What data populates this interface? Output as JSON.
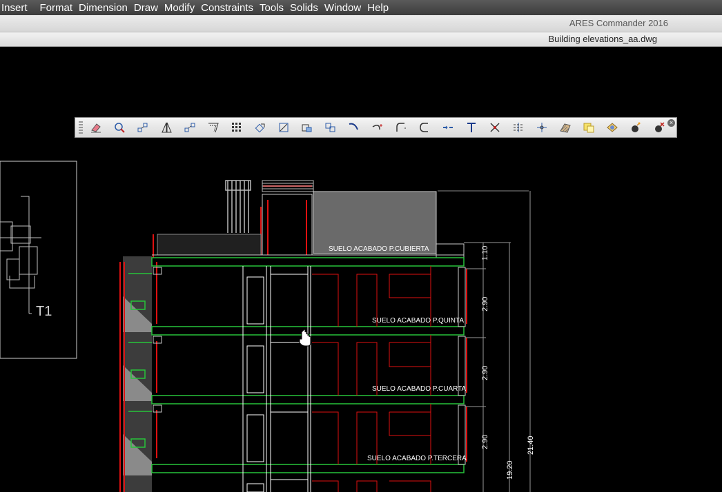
{
  "menu": [
    "Insert",
    "Format",
    "Dimension",
    "Draw",
    "Modify",
    "Constraints",
    "Tools",
    "Solids",
    "Window",
    "Help"
  ],
  "app_title": "ARES Commander 2016",
  "document_tab": "Building elevations_aa.dwg",
  "toolbar": {
    "tools": [
      "eraser-icon",
      "copy-icon",
      "mirror-icon",
      "offset-icon",
      "offset-parallel-icon",
      "chamfer-icon",
      "array-icon",
      "move-icon",
      "rotate-icon",
      "scale-icon",
      "stretch-icon",
      "trim-icon",
      "extend-icon",
      "fillet-icon",
      "arc-icon",
      "break-icon",
      "join-icon",
      "explode-icon",
      "divide-icon",
      "split-icon",
      "hatch-icon",
      "region-icon",
      "boolean-icon",
      "bomb-icon",
      "bomb-delete-icon"
    ],
    "close": "×"
  },
  "drawing": {
    "section_label": "T1",
    "levels": [
      "SUELO ACABADO P.CUBIERTA",
      "SUELO ACABADO P.QUINTA",
      "SUELO ACABADO P.CUARTA",
      "SUELO ACABADO P.TERCERA"
    ],
    "dimensions": [
      "1.10",
      "2.90",
      "2.90",
      "2.90",
      "21.40",
      "19.20"
    ]
  },
  "colors": {
    "menubar": "#3c3c3c",
    "canvas": "#000000",
    "green_lines": "#27c43a",
    "red_lines": "#e01010"
  }
}
